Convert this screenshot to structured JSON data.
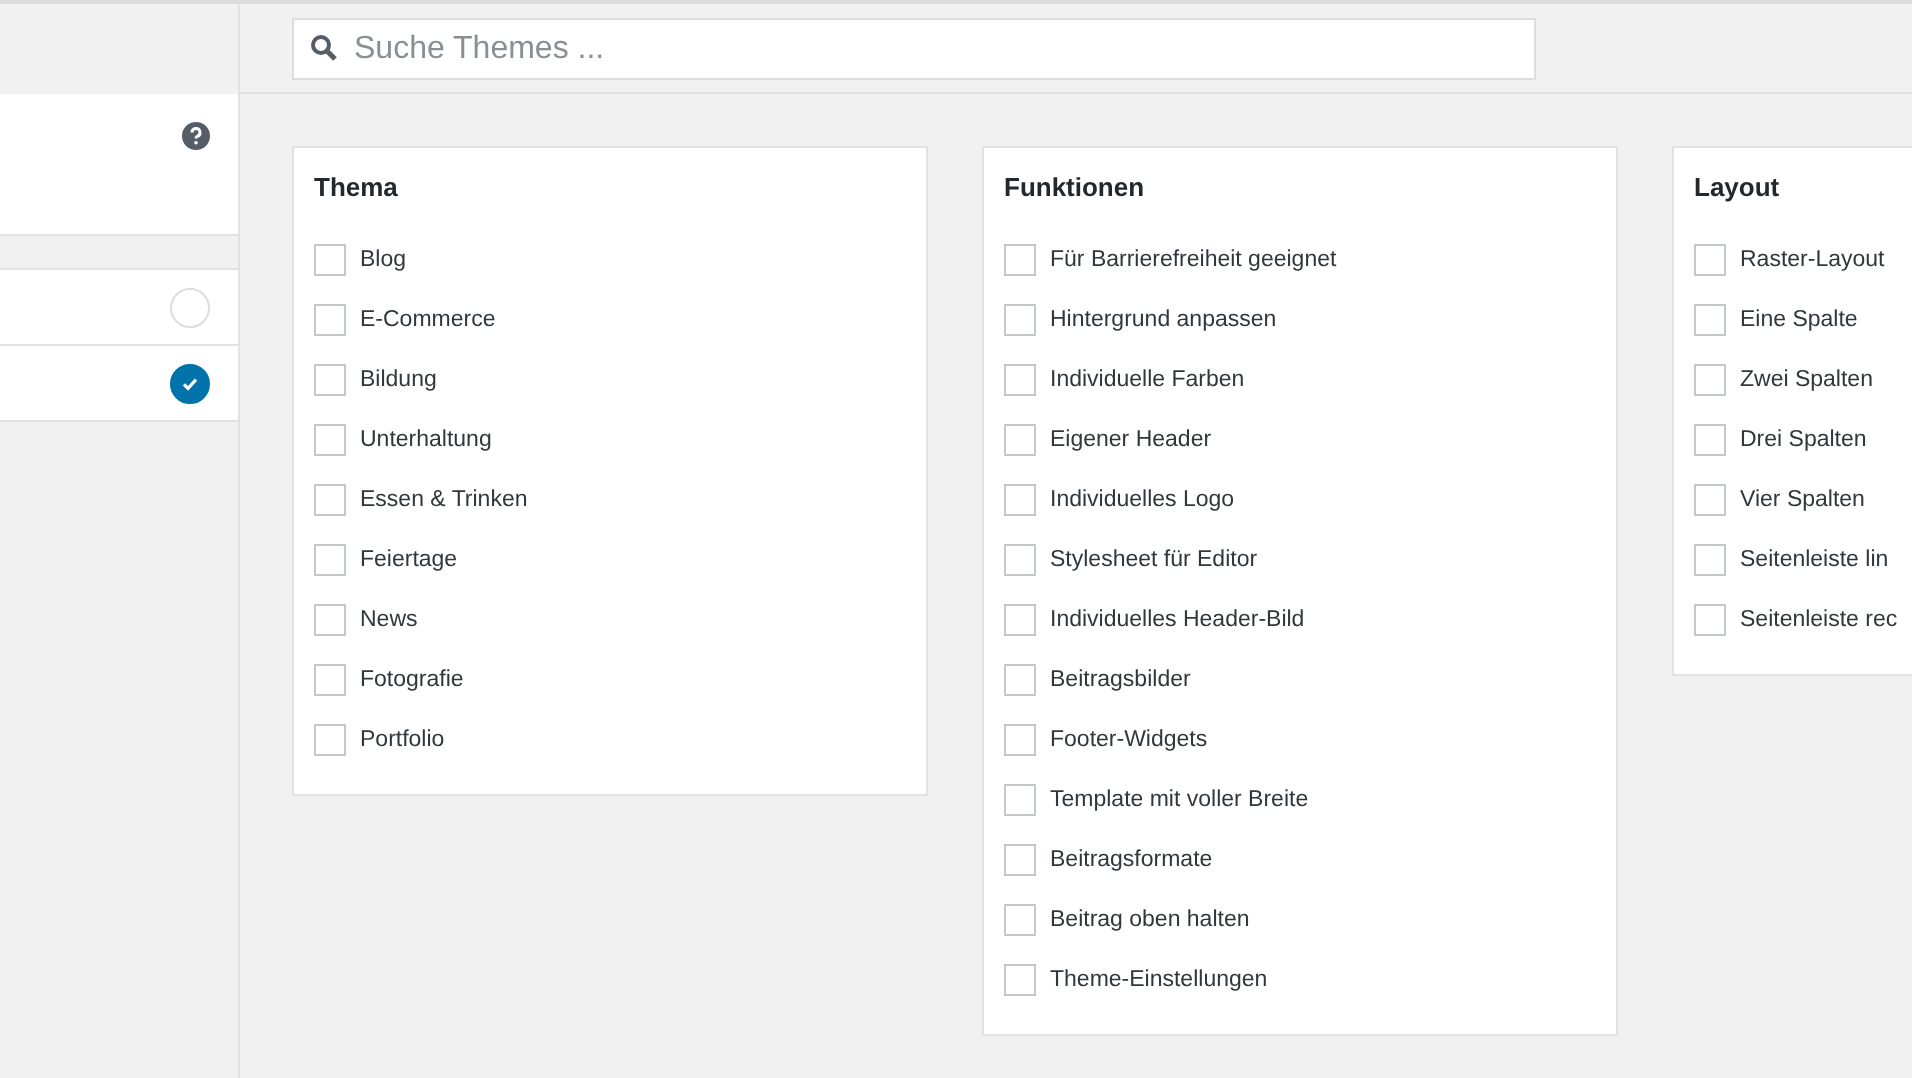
{
  "search": {
    "placeholder": "Suche Themes ..."
  },
  "sidebar": {
    "options": [
      {
        "selected": false
      },
      {
        "selected": true
      }
    ]
  },
  "filter_groups": [
    {
      "title": "Thema",
      "items": [
        {
          "label": "Blog",
          "checked": false
        },
        {
          "label": "E-Commerce",
          "checked": false
        },
        {
          "label": "Bildung",
          "checked": false
        },
        {
          "label": "Unterhaltung",
          "checked": false
        },
        {
          "label": "Essen & Trinken",
          "checked": false
        },
        {
          "label": "Feiertage",
          "checked": false
        },
        {
          "label": "News",
          "checked": false
        },
        {
          "label": "Fotografie",
          "checked": false
        },
        {
          "label": "Portfolio",
          "checked": false
        }
      ]
    },
    {
      "title": "Funktionen",
      "items": [
        {
          "label": "Für Barrierefreiheit geeignet",
          "checked": false
        },
        {
          "label": "Hintergrund anpassen",
          "checked": false
        },
        {
          "label": "Individuelle Farben",
          "checked": false
        },
        {
          "label": "Eigener Header",
          "checked": false
        },
        {
          "label": "Individuelles Logo",
          "checked": false
        },
        {
          "label": "Stylesheet für Editor",
          "checked": false
        },
        {
          "label": "Individuelles Header-Bild",
          "checked": false
        },
        {
          "label": "Beitragsbilder",
          "checked": false
        },
        {
          "label": "Footer-Widgets",
          "checked": false
        },
        {
          "label": "Template mit voller Breite",
          "checked": false
        },
        {
          "label": "Beitragsformate",
          "checked": false
        },
        {
          "label": "Beitrag oben halten",
          "checked": false
        },
        {
          "label": "Theme-Einstellungen",
          "checked": false
        }
      ]
    },
    {
      "title": "Layout",
      "items": [
        {
          "label": "Raster-Layout",
          "checked": false
        },
        {
          "label": "Eine Spalte",
          "checked": false
        },
        {
          "label": "Zwei Spalten",
          "checked": false
        },
        {
          "label": "Drei Spalten",
          "checked": false
        },
        {
          "label": "Vier Spalten",
          "checked": false
        },
        {
          "label": "Seitenleiste lin",
          "checked": false
        },
        {
          "label": "Seitenleiste rec",
          "checked": false
        }
      ]
    }
  ]
}
